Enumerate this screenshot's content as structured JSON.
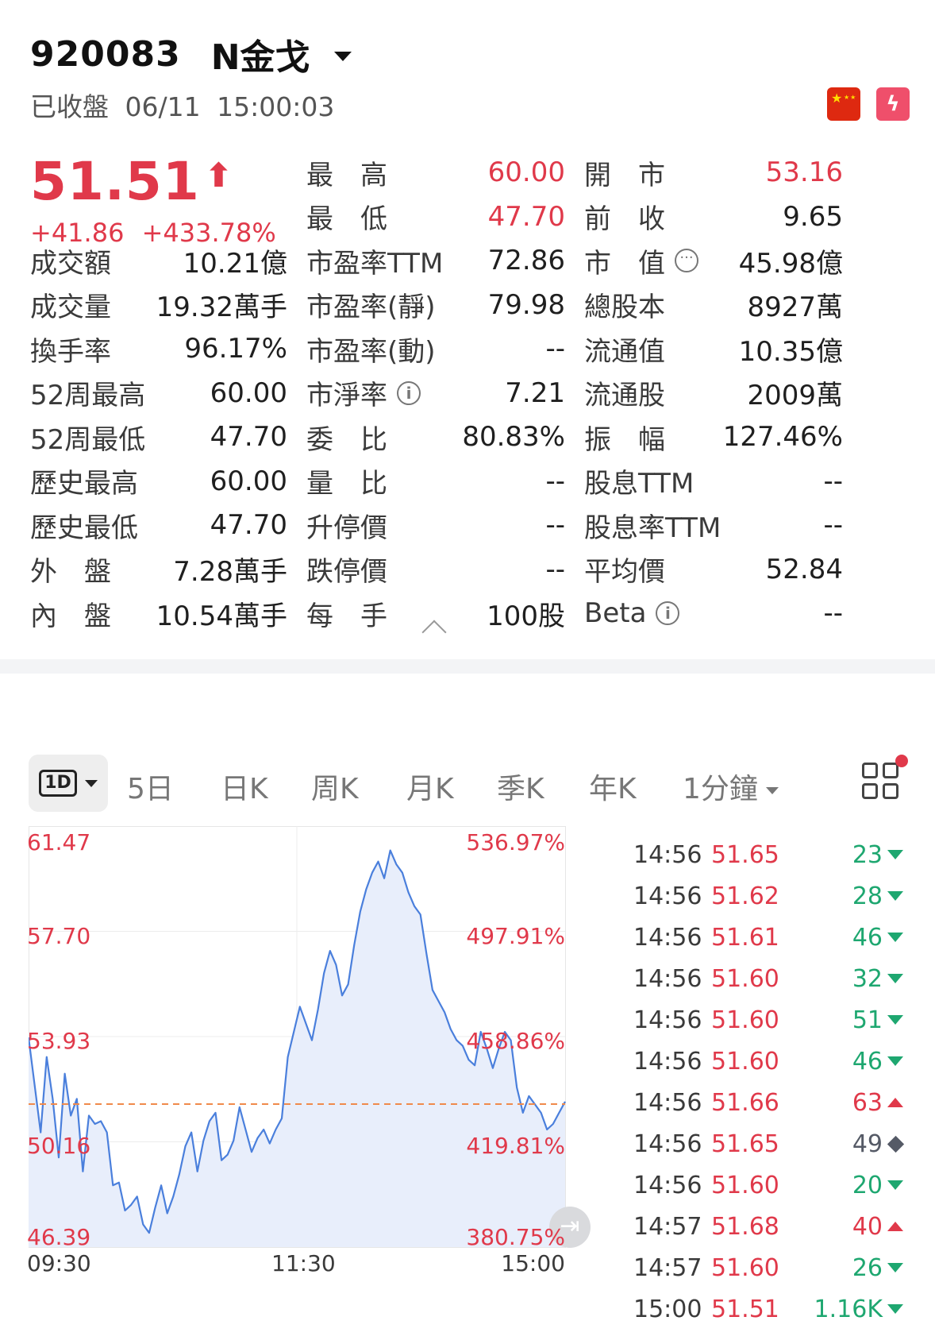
{
  "stock": {
    "code": "920083",
    "name": "N金戈",
    "status": "已收盤",
    "date": "06/11",
    "time": "15:00:03"
  },
  "quote": {
    "price": "51.51",
    "change": "+41.86",
    "change_pct": "+433.78%",
    "color_up": "#e0394a",
    "color_down": "#1ea770"
  },
  "stats": {
    "col1": [
      {
        "label": "成交額",
        "value": "10.21億"
      },
      {
        "label": "成交量",
        "value": "19.32萬手"
      },
      {
        "label": "換手率",
        "value": "96.17%"
      },
      {
        "label": "52周最高",
        "value": "60.00"
      },
      {
        "label": "52周最低",
        "value": "47.70"
      },
      {
        "label": "歷史最高",
        "value": "60.00"
      },
      {
        "label": "歷史最低",
        "value": "47.70"
      },
      {
        "label": "外　盤",
        "value": "7.28萬手"
      },
      {
        "label": "內　盤",
        "value": "10.54萬手"
      }
    ],
    "col2": [
      {
        "label": "最　高",
        "value": "60.00"
      },
      {
        "label": "最　低",
        "value": "47.70"
      },
      {
        "label": "市盈率TTM",
        "value": "72.86"
      },
      {
        "label": "市盈率(靜)",
        "value": "79.98"
      },
      {
        "label": "市盈率(動)",
        "value": "--"
      },
      {
        "label": "市淨率",
        "value": "7.21"
      },
      {
        "label": "委　比",
        "value": "80.83%"
      },
      {
        "label": "量　比",
        "value": "--"
      },
      {
        "label": "升停價",
        "value": "--"
      },
      {
        "label": "跌停價",
        "value": "--"
      },
      {
        "label": "每　手",
        "value": "100股"
      }
    ],
    "col3": [
      {
        "label": "開　市",
        "value": "53.16"
      },
      {
        "label": "前　收",
        "value": "9.65"
      },
      {
        "label": "市　值",
        "value": "45.98億"
      },
      {
        "label": "總股本",
        "value": "8927萬"
      },
      {
        "label": "流通值",
        "value": "10.35億"
      },
      {
        "label": "流通股",
        "value": "2009萬"
      },
      {
        "label": "振　幅",
        "value": "127.46%"
      },
      {
        "label": "股息TTM",
        "value": "--"
      },
      {
        "label": "股息率TTM",
        "value": "--"
      },
      {
        "label": "平均價",
        "value": "52.84"
      },
      {
        "label": "Beta",
        "value": "--"
      }
    ]
  },
  "tabs": {
    "active_label": "1D",
    "items": [
      "5日",
      "日K",
      "周K",
      "月K",
      "季K",
      "年K"
    ],
    "minute_label": "1分鐘"
  },
  "chart_data": {
    "type": "line",
    "x_start": "09:30",
    "x_mid": "11:30",
    "x_end": "15:00",
    "ylim": [
      46.39,
      61.47
    ],
    "left_ticks": [
      "61.47",
      "57.70",
      "53.93",
      "50.16",
      "46.39"
    ],
    "right_ticks": [
      "536.97%",
      "497.91%",
      "458.86%",
      "419.81%",
      "380.75%"
    ],
    "reference_value": 51.51,
    "line_color": "#4a7fdc",
    "fill_color": "#e8eefb",
    "reference_color": "#f08a4b",
    "values": [
      53.9,
      52.2,
      50.5,
      53.2,
      51.7,
      49.6,
      52.6,
      51.1,
      51.7,
      49.1,
      51.1,
      50.8,
      50.9,
      50.5,
      48.6,
      48.7,
      47.7,
      47.9,
      48.2,
      47.2,
      46.9,
      47.8,
      48.6,
      47.6,
      48.2,
      49.0,
      50.0,
      50.5,
      49.1,
      50.2,
      50.9,
      51.2,
      49.5,
      49.7,
      50.2,
      51.4,
      50.6,
      49.8,
      50.3,
      50.6,
      50.1,
      50.6,
      51.0,
      53.2,
      54.1,
      55.0,
      54.4,
      53.8,
      54.9,
      56.2,
      57.0,
      56.5,
      55.4,
      55.8,
      57.2,
      58.4,
      59.2,
      59.8,
      60.2,
      59.6,
      60.6,
      60.1,
      59.8,
      59.1,
      58.6,
      58.3,
      56.9,
      55.6,
      55.2,
      54.8,
      54.2,
      53.8,
      53.6,
      53.1,
      52.9,
      54.1,
      53.5,
      52.8,
      53.5,
      54.1,
      53.8,
      52.1,
      51.2,
      51.8,
      51.5,
      51.2,
      50.6,
      50.8,
      51.2,
      51.6
    ],
    "tooltip_values": []
  },
  "ticks": [
    {
      "time": "14:56",
      "price": "51.65",
      "vol": "23",
      "dir": "down"
    },
    {
      "time": "14:56",
      "price": "51.62",
      "vol": "28",
      "dir": "down"
    },
    {
      "time": "14:56",
      "price": "51.61",
      "vol": "46",
      "dir": "down"
    },
    {
      "time": "14:56",
      "price": "51.60",
      "vol": "32",
      "dir": "down"
    },
    {
      "time": "14:56",
      "price": "51.60",
      "vol": "51",
      "dir": "down"
    },
    {
      "time": "14:56",
      "price": "51.60",
      "vol": "46",
      "dir": "down"
    },
    {
      "time": "14:56",
      "price": "51.66",
      "vol": "63",
      "dir": "up"
    },
    {
      "time": "14:56",
      "price": "51.65",
      "vol": "49",
      "dir": "neutral"
    },
    {
      "time": "14:56",
      "price": "51.60",
      "vol": "20",
      "dir": "down"
    },
    {
      "time": "14:57",
      "price": "51.68",
      "vol": "40",
      "dir": "up"
    },
    {
      "time": "14:57",
      "price": "51.60",
      "vol": "26",
      "dir": "down"
    },
    {
      "time": "15:00",
      "price": "51.51",
      "vol": "1.16K",
      "dir": "down"
    }
  ],
  "icons": {
    "flag": "china-flag-icon",
    "bolt": "lightning-badge-icon",
    "info": "info-icon",
    "more": "more-options-icon",
    "grid": "layout-grid-icon",
    "collapse": "chevron-up-icon",
    "jump": "jump-to-end-icon"
  }
}
